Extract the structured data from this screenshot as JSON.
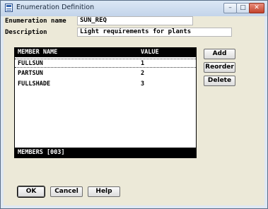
{
  "window": {
    "title": "Enumeration Definition",
    "minimize_glyph": "–",
    "maximize_glyph": "□",
    "close_glyph": "✕"
  },
  "form": {
    "enum_name_label": "Enumeration name",
    "enum_name_value": "SUN_REQ",
    "description_label": "Description",
    "description_value": "Light requirements for plants"
  },
  "members": {
    "columns": [
      "MEMBER NAME",
      "VALUE"
    ],
    "rows": [
      {
        "name": "FULLSUN",
        "value": "1"
      },
      {
        "name": "PARTSUN",
        "value": "2"
      },
      {
        "name": "FULLSHADE",
        "value": "3"
      }
    ],
    "footer": "MEMBERS [003]"
  },
  "side_buttons": {
    "add": "Add",
    "reorder": "Reorder",
    "delete": "Delete"
  },
  "bottom_buttons": {
    "ok": "OK",
    "cancel": "Cancel",
    "help": "Help"
  }
}
